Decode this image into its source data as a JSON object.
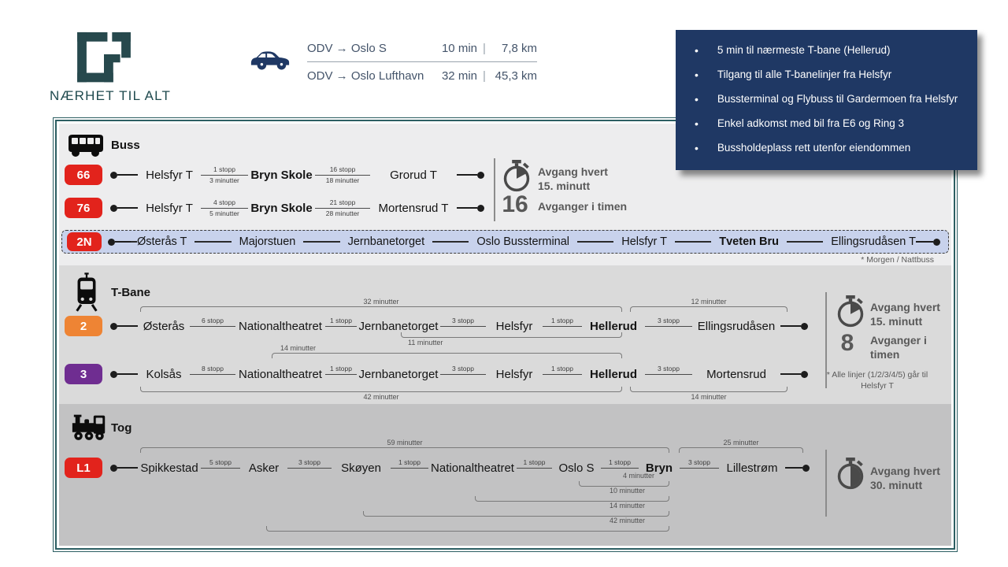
{
  "brand": {
    "title": "NÆRHET TIL ALT"
  },
  "drive": {
    "rows": [
      {
        "route": "ODV → Oslo S",
        "time": "10 min",
        "sep": "|",
        "dist": "7,8 km"
      },
      {
        "route": "ODV → Oslo Lufthavn",
        "time": "32 min",
        "sep": "|",
        "dist": "45,3 km"
      }
    ]
  },
  "callout": {
    "bg": "#1F3864",
    "bullets": [
      "5 min til nærmeste T-bane (Hellerud)",
      "Tilgang til alle T-banelinjer fra Helsfyr",
      "Bussterminal og Flybuss til Gardermoen fra Helsfyr",
      "Enkel adkomst med bil fra E6 og Ring 3",
      "Bussholdeplass rett utenfor eiendommen"
    ]
  },
  "colors": {
    "accent_teal": "#2D5F63",
    "ruter_red": "#E2231C",
    "line2_orange": "#EE8434",
    "line3_purple": "#6F2D91",
    "navy": "#1F3864"
  },
  "buss": {
    "label": "Buss",
    "routes": [
      {
        "badge": "66",
        "s1": "Helsfyr T",
        "leg1_stops": "1 stopp",
        "leg1_time": "3 minutter",
        "s2": "Bryn Skole",
        "leg2_stops": "16 stopp",
        "leg2_time": "18 minutter",
        "s3": "Grorud T"
      },
      {
        "badge": "76",
        "s1": "Helsfyr T",
        "leg1_stops": "4 stopp",
        "leg1_time": "5 minutter",
        "s2": "Bryn Skole",
        "leg2_stops": "21 stopp",
        "leg2_time": "28 minutter",
        "s3": "Mortensrud T"
      }
    ],
    "night": {
      "badge": "2N",
      "stations": [
        "Østerås T",
        "Majorstuen",
        "Jernbanetorget",
        "Oslo Bussterminal",
        "Helsfyr T",
        "Tveten Bru",
        "Ellingsrudåsen T"
      ]
    },
    "footnote": "* Morgen / Nattbuss",
    "info": {
      "headway": "Avgang hvert 15. minutt",
      "count": "16",
      "count_label": "Avganger i timen"
    }
  },
  "tbane": {
    "label": "T-Bane",
    "routes": [
      {
        "badge": "2",
        "stations": [
          "Østerås",
          "Nationaltheatret",
          "Jernbanetorget",
          "Helsfyr",
          "Hellerud",
          "Ellingsrudåsen"
        ],
        "legs": [
          "6 stopp",
          "1 stopp",
          "3 stopp",
          "1 stopp",
          "3 stopp"
        ]
      },
      {
        "badge": "3",
        "stations": [
          "Kolsås",
          "Nationaltheatret",
          "Jernbanetorget",
          "Helsfyr",
          "Hellerud",
          "Mortensrud"
        ],
        "legs": [
          "8 stopp",
          "1 stopp",
          "3 stopp",
          "1 stopp",
          "3 stopp"
        ]
      }
    ],
    "brackets": {
      "b32": "32 minutter",
      "b12": "12 minutter",
      "b11": "11 minutter",
      "b14a": "14 minutter",
      "b42": "42 minutter",
      "b14b": "14 minutter"
    },
    "info": {
      "headway": "Avgang hvert 15. minutt",
      "count": "8",
      "count_label": "Avganger i timen",
      "footnote": "* Alle linjer (1/2/3/4/5) går til Helsfyr T"
    }
  },
  "tog": {
    "label": "Tog",
    "route": {
      "badge": "L1",
      "stations": [
        "Spikkestad",
        "Asker",
        "Skøyen",
        "Nationaltheatret",
        "Oslo S",
        "Bryn",
        "Lillestrøm"
      ],
      "legs": [
        "5 stopp",
        "3 stopp",
        "1 stopp",
        "1 stopp",
        "1 stopp",
        "3 stopp"
      ]
    },
    "brackets": {
      "b59": "59 minutter",
      "b25": "25 minutter",
      "b4": "4 minutter",
      "b10": "10 minutter",
      "b14": "14 minutter",
      "b42": "42 minutter"
    },
    "info": {
      "headway": "Avgang hvert 30. minutt"
    }
  }
}
